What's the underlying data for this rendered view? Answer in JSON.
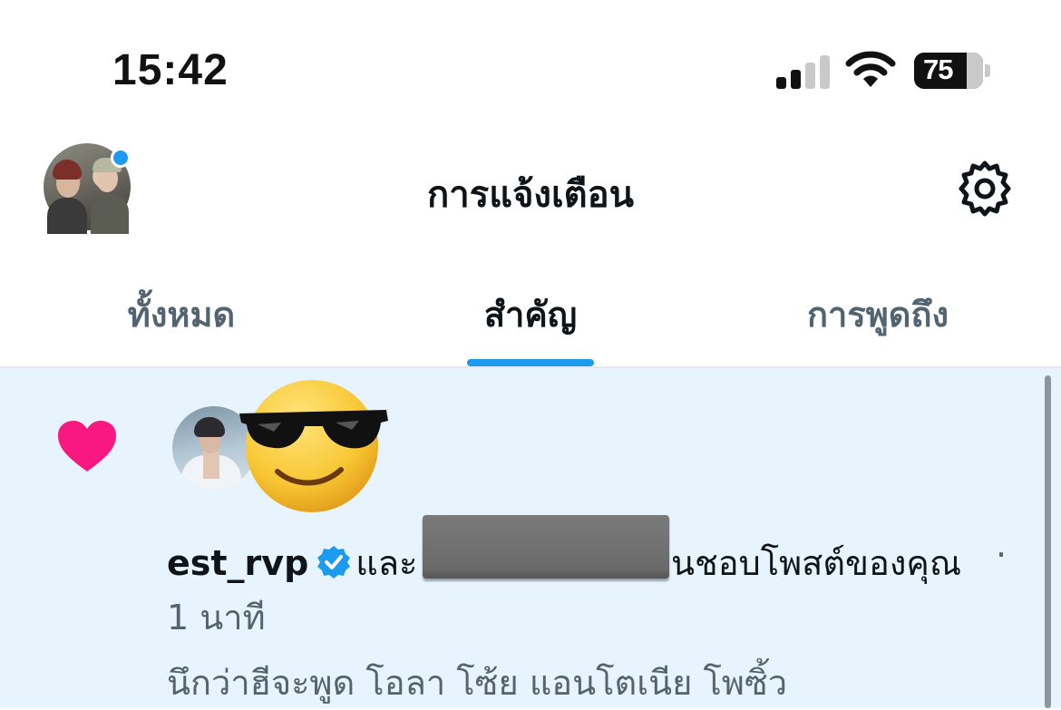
{
  "status_bar": {
    "time": "15:42",
    "battery": "75",
    "icons": [
      "cellular-signal-icon",
      "wifi-icon",
      "battery-icon"
    ]
  },
  "header": {
    "title": "การแจ้งเตือน",
    "settings_icon": "gear-icon"
  },
  "tabs": [
    {
      "label": "ทั้งหมด",
      "active": false
    },
    {
      "label": "สำคัญ",
      "active": true
    },
    {
      "label": "การพูดถึง",
      "active": false
    }
  ],
  "notification": {
    "type_icon": "heart-icon",
    "username": "est_rvp",
    "verified": true,
    "text_before_redaction": "และ",
    "text_after_redaction": "นชอบโพสต์ของคุณ",
    "separator": "·",
    "time": "1 นาที",
    "post_preview": "นึกว่าฮีจะพูด โอลา โซ้ย แอนโตเนีย โพซิ้ว"
  },
  "colors": {
    "accent": "#1d9bf0",
    "heart": "#f91880",
    "highlight_bg": "#e8f4fd",
    "secondary_text": "#536471"
  }
}
